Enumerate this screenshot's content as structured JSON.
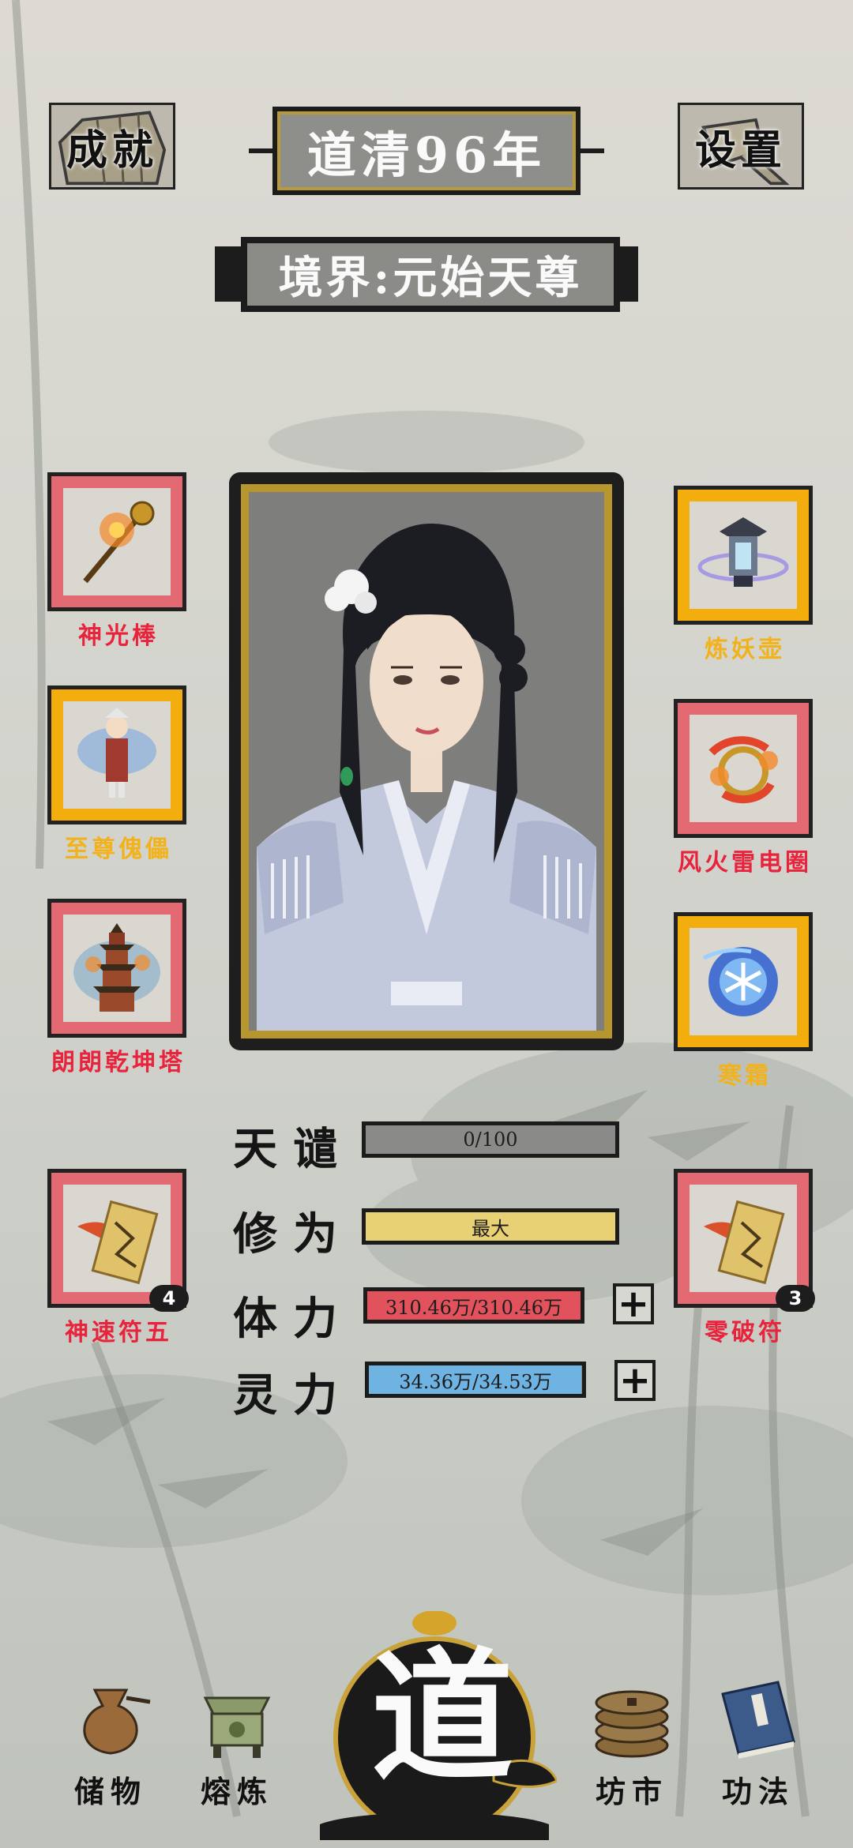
{
  "header": {
    "achievement_label": "成就",
    "year_title": "道清96年",
    "settings_label": "设置",
    "realm": "境界:元始天尊"
  },
  "equipment_left": [
    {
      "name": "神光棒",
      "rarity": "red",
      "icon": "staff-icon"
    },
    {
      "name": "至尊傀儡",
      "rarity": "gold",
      "icon": "puppet-icon"
    },
    {
      "name": "朗朗乾坤塔",
      "rarity": "red",
      "icon": "pagoda-icon"
    }
  ],
  "equipment_right": [
    {
      "name": "炼妖壶",
      "rarity": "gold",
      "icon": "lantern-icon"
    },
    {
      "name": "风火雷电圈",
      "rarity": "red",
      "icon": "ring-icon"
    },
    {
      "name": "寒霜",
      "rarity": "gold",
      "icon": "frost-orb-icon"
    }
  ],
  "talismans": {
    "left": {
      "name": "神速符五",
      "count": "4",
      "icon": "talisman-icon"
    },
    "right": {
      "name": "零破符",
      "count": "3",
      "icon": "talisman-icon"
    }
  },
  "stats": {
    "tribulation": {
      "label": "天谴",
      "value": "0/100",
      "fill": 0.0,
      "color": "#8a8a88"
    },
    "cultivation": {
      "label": "修为",
      "value": "最大",
      "fill": 1.0,
      "color": "#e8d174"
    },
    "stamina": {
      "label": "体力",
      "value": "310.46万/310.46万",
      "fill": 1.0,
      "color": "#e2525c"
    },
    "spirit": {
      "label": "灵力",
      "value": "34.36万/34.53万",
      "fill": 0.995,
      "color": "#6fb3e3"
    }
  },
  "nav": {
    "storage": "储物",
    "smelting": "熔炼",
    "dao": "道",
    "market": "坊市",
    "techniques": "功法"
  },
  "colors": {
    "red_rarity": "#e36a72",
    "gold_rarity": "#f3ad0c",
    "red_text": "#e8233b",
    "gold_text": "#f2b21b"
  }
}
